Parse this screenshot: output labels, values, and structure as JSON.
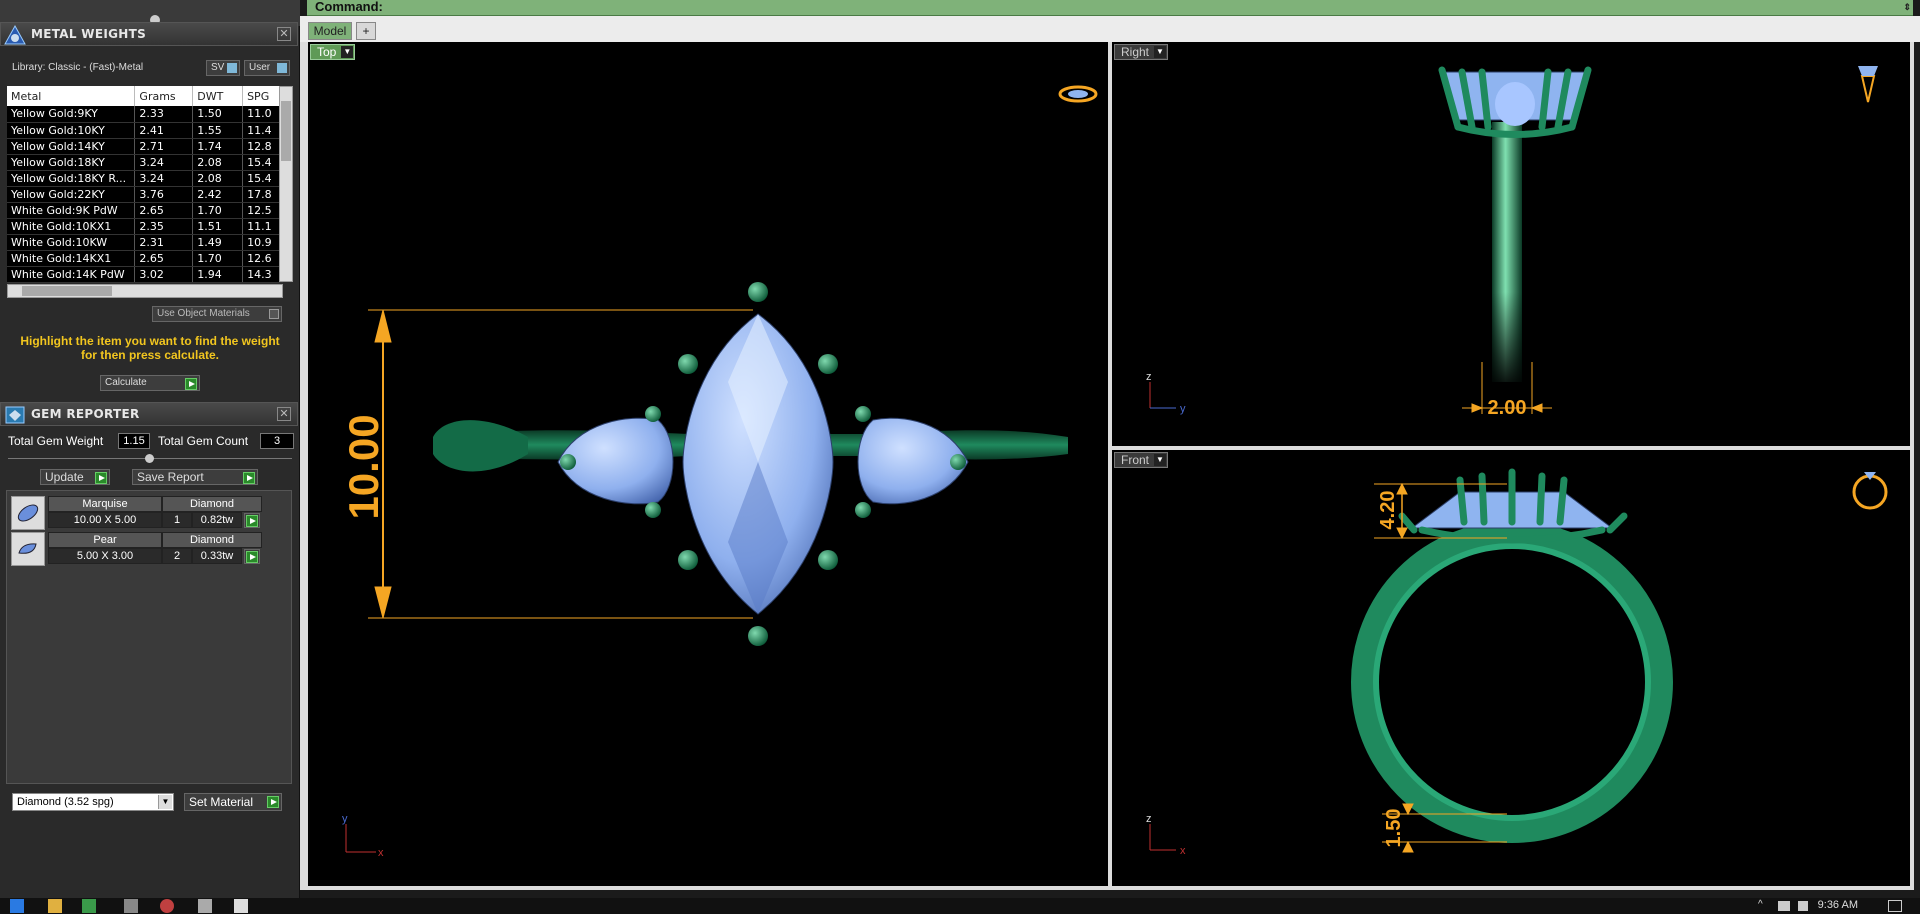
{
  "command": {
    "label": "Command:"
  },
  "tabs": [
    {
      "label": "Model"
    },
    {
      "label": "+"
    }
  ],
  "metal_weights": {
    "title": "METAL WEIGHTS",
    "library": "Library: Classic - (Fast)-Metal",
    "sv_label": "SV",
    "user_label": "User",
    "columns": [
      "Metal",
      "Grams",
      "DWT",
      "SPG"
    ],
    "rows": [
      [
        "Yellow Gold:9KY",
        "2.33",
        "1.50",
        "11.0"
      ],
      [
        "Yellow Gold:10KY",
        "2.41",
        "1.55",
        "11.4"
      ],
      [
        "Yellow Gold:14KY",
        "2.71",
        "1.74",
        "12.8"
      ],
      [
        "Yellow Gold:18KY",
        "3.24",
        "2.08",
        "15.4"
      ],
      [
        "Yellow Gold:18KY R...",
        "3.24",
        "2.08",
        "15.4"
      ],
      [
        "Yellow Gold:22KY",
        "3.76",
        "2.42",
        "17.8"
      ],
      [
        "White Gold:9K PdW",
        "2.65",
        "1.70",
        "12.5"
      ],
      [
        "White Gold:10KX1",
        "2.35",
        "1.51",
        "11.1"
      ],
      [
        "White Gold:10KW",
        "2.31",
        "1.49",
        "10.9"
      ],
      [
        "White Gold:14KX1",
        "2.65",
        "1.70",
        "12.6"
      ],
      [
        "White Gold:14K PdW",
        "3.02",
        "1.94",
        "14.3"
      ]
    ],
    "use_object_materials": "Use Object Materials",
    "hint": "Highlight the item you want to find the weight for then press calculate.",
    "calculate_label": "Calculate"
  },
  "gem_reporter": {
    "title": "GEM REPORTER",
    "total_weight_label": "Total Gem Weight",
    "total_weight_value": "1.15",
    "total_count_label": "Total Gem Count",
    "total_count_value": "3",
    "update_label": "Update",
    "save_report_label": "Save Report",
    "gems": [
      {
        "shape": "Marquise",
        "material": "Diamond",
        "size": "10.00 X 5.00",
        "count": "1",
        "weight": "0.82tw"
      },
      {
        "shape": "Pear",
        "material": "Diamond",
        "size": "5.00 X 3.00",
        "count": "2",
        "weight": "0.33tw"
      }
    ],
    "material_select": "Diamond    (3.52 spg)",
    "set_material_label": "Set Material"
  },
  "viewports": {
    "top": {
      "label": "Top",
      "dimension": "10.00",
      "axis_y": "y",
      "axis_x": "x"
    },
    "right": {
      "label": "Right",
      "dimension": "2.00",
      "axis_z": "z",
      "axis_y": "y"
    },
    "front": {
      "label": "Front",
      "dimension_top": "4.20",
      "dimension_bottom": "1.50",
      "axis_z": "z",
      "axis_x": "x"
    }
  },
  "colors": {
    "ring": "#1f8a5e",
    "gem": "#8fb4f0",
    "dimension": "#f5a623",
    "command_bar": "#7fb279"
  },
  "taskbar": {
    "clock": "9:36 AM"
  }
}
